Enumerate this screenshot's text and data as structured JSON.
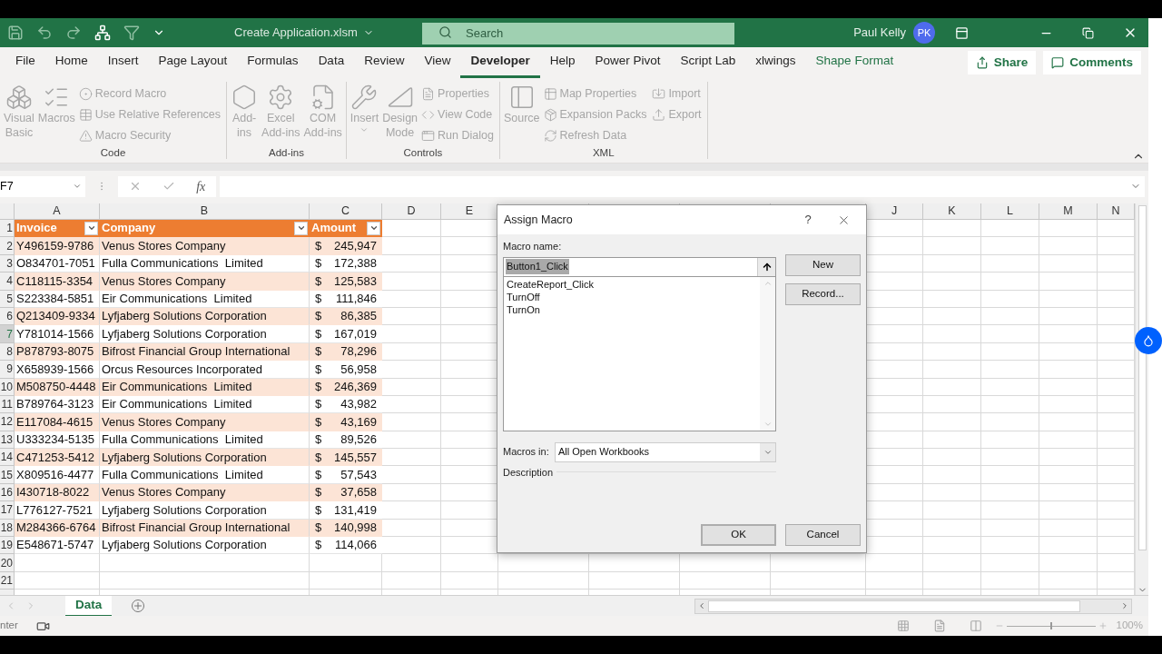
{
  "title_bar": {
    "file_name": "Create Application.xlsm",
    "search_placeholder": "Search",
    "user_name": "Paul Kelly",
    "avatar_initials": "PK"
  },
  "tabs": [
    {
      "label": "File",
      "selected": false,
      "kind": "normal"
    },
    {
      "label": "Home",
      "selected": false,
      "kind": "normal"
    },
    {
      "label": "Insert",
      "selected": false,
      "kind": "normal"
    },
    {
      "label": "Page Layout",
      "selected": false,
      "kind": "normal"
    },
    {
      "label": "Formulas",
      "selected": false,
      "kind": "normal"
    },
    {
      "label": "Data",
      "selected": false,
      "kind": "normal"
    },
    {
      "label": "Review",
      "selected": false,
      "kind": "normal"
    },
    {
      "label": "View",
      "selected": false,
      "kind": "normal"
    },
    {
      "label": "Developer",
      "selected": true,
      "kind": "normal"
    },
    {
      "label": "Help",
      "selected": false,
      "kind": "normal"
    },
    {
      "label": "Power Pivot",
      "selected": false,
      "kind": "normal"
    },
    {
      "label": "Script Lab",
      "selected": false,
      "kind": "normal"
    },
    {
      "label": "xlwings",
      "selected": false,
      "kind": "normal"
    },
    {
      "label": "Shape Format",
      "selected": false,
      "kind": "contextual"
    }
  ],
  "share_button": "Share",
  "comments_button": "Comments",
  "ribbon": {
    "groups": [
      {
        "label": "Code",
        "large": [
          {
            "lines": [
              "Visual",
              "Basic"
            ],
            "disabled": true
          },
          {
            "lines": [
              "Macros"
            ],
            "disabled": true
          }
        ],
        "small_columns": [
          [
            {
              "label": "Record Macro",
              "disabled": true
            },
            {
              "label": "Use Relative References",
              "disabled": true
            },
            {
              "label": "Macro Security",
              "disabled": true
            }
          ]
        ]
      },
      {
        "label": "Add-ins",
        "large": [
          {
            "lines": [
              "Add-",
              "ins"
            ],
            "disabled": true
          },
          {
            "lines": [
              "Excel",
              "Add-ins"
            ],
            "disabled": true
          },
          {
            "lines": [
              "COM",
              "Add-ins"
            ],
            "disabled": true
          }
        ]
      },
      {
        "label": "Controls",
        "large": [
          {
            "lines": [
              "Insert"
            ],
            "disabled": true
          },
          {
            "lines": [
              "Design",
              "Mode"
            ],
            "disabled": true
          }
        ],
        "small_columns": [
          [
            {
              "label": "Properties",
              "disabled": true
            },
            {
              "label": "View Code",
              "disabled": true
            },
            {
              "label": "Run Dialog",
              "disabled": true
            }
          ]
        ]
      },
      {
        "label": "XML",
        "large": [
          {
            "lines": [
              "Source"
            ],
            "disabled": true
          }
        ],
        "small_columns": [
          [
            {
              "label": "Map Properties",
              "disabled": true
            },
            {
              "label": "Expansion Packs",
              "disabled": true
            },
            {
              "label": "Refresh Data",
              "disabled": true
            }
          ],
          [
            {
              "label": "Import",
              "disabled": true
            },
            {
              "label": "Export",
              "disabled": true
            }
          ]
        ]
      }
    ]
  },
  "formula_bar": {
    "name_box": "F7",
    "function_symbol": "fx"
  },
  "columns": [
    {
      "label": "A"
    },
    {
      "label": "B"
    },
    {
      "label": "C"
    },
    {
      "label": "D"
    },
    {
      "label": "E"
    },
    {
      "label": "J"
    },
    {
      "label": "K"
    },
    {
      "label": "L"
    },
    {
      "label": "M"
    },
    {
      "label": "N"
    }
  ],
  "table": {
    "header": {
      "row": "1",
      "cells": [
        "Invoice",
        "Company",
        "Amount"
      ]
    },
    "rows": [
      {
        "row": "2",
        "invoice": "Y496159-9786",
        "company": "Venus Stores Company",
        "currency": "$",
        "amount": "245,947",
        "banded": true,
        "selected": false
      },
      {
        "row": "3",
        "invoice": "O834701-7051",
        "company": "Fulla Communications  Limited",
        "currency": "$",
        "amount": "172,388",
        "banded": false,
        "selected": false
      },
      {
        "row": "4",
        "invoice": "C118115-3354",
        "company": "Venus Stores Company",
        "currency": "$",
        "amount": "125,583",
        "banded": true,
        "selected": false
      },
      {
        "row": "5",
        "invoice": "S223384-5851",
        "company": "Eir Communications  Limited",
        "currency": "$",
        "amount": "111,846",
        "banded": false,
        "selected": false
      },
      {
        "row": "6",
        "invoice": "Q213409-9334",
        "company": "Lyfjaberg Solutions Corporation",
        "currency": "$",
        "amount": "86,385",
        "banded": true,
        "selected": false
      },
      {
        "row": "7",
        "invoice": "Y781014-1566",
        "company": "Lyfjaberg Solutions Corporation",
        "currency": "$",
        "amount": "167,019",
        "banded": false,
        "selected": true
      },
      {
        "row": "8",
        "invoice": "P878793-8075",
        "company": "Bifrost Financial Group International",
        "currency": "$",
        "amount": "78,296",
        "banded": true,
        "selected": false
      },
      {
        "row": "9",
        "invoice": "X658939-1566",
        "company": "Orcus Resources Incorporated",
        "currency": "$",
        "amount": "56,958",
        "banded": false,
        "selected": false
      },
      {
        "row": "10",
        "invoice": "M508750-4448",
        "company": "Eir Communications  Limited",
        "currency": "$",
        "amount": "246,369",
        "banded": true,
        "selected": false
      },
      {
        "row": "11",
        "invoice": "B789764-3123",
        "company": "Eir Communications  Limited",
        "currency": "$",
        "amount": "43,982",
        "banded": false,
        "selected": false
      },
      {
        "row": "12",
        "invoice": "E117084-4615",
        "company": "Venus Stores Company",
        "currency": "$",
        "amount": "43,169",
        "banded": true,
        "selected": false
      },
      {
        "row": "13",
        "invoice": "U333234-5135",
        "company": "Fulla Communications  Limited",
        "currency": "$",
        "amount": "89,526",
        "banded": false,
        "selected": false
      },
      {
        "row": "14",
        "invoice": "C471253-5412",
        "company": "Lyfjaberg Solutions Corporation",
        "currency": "$",
        "amount": "145,557",
        "banded": true,
        "selected": false
      },
      {
        "row": "15",
        "invoice": "X809516-4477",
        "company": "Fulla Communications  Limited",
        "currency": "$",
        "amount": "57,543",
        "banded": false,
        "selected": false
      },
      {
        "row": "16",
        "invoice": "I430718-8022",
        "company": "Venus Stores Company",
        "currency": "$",
        "amount": "37,658",
        "banded": true,
        "selected": false
      },
      {
        "row": "17",
        "invoice": "L776127-7521",
        "company": "Lyfjaberg Solutions Corporation",
        "currency": "$",
        "amount": "131,419",
        "banded": false,
        "selected": false
      },
      {
        "row": "18",
        "invoice": "M284366-6764",
        "company": "Bifrost Financial Group International",
        "currency": "$",
        "amount": "140,998",
        "banded": true,
        "selected": false
      },
      {
        "row": "19",
        "invoice": "E548671-5747",
        "company": "Lyfjaberg Solutions Corporation",
        "currency": "$",
        "amount": "114,066",
        "banded": false,
        "selected": false
      }
    ],
    "empty_rows": [
      "20",
      "21"
    ]
  },
  "sheet_tabs": [
    {
      "label": "Data",
      "selected": true
    }
  ],
  "status_bar": {
    "mode": "nter",
    "zoom": {
      "level": 0.5,
      "reading": "100%"
    }
  },
  "dialog": {
    "title": "Assign Macro",
    "help": "?",
    "macro_name_label": "Macro name:",
    "macro_name_value": "Button1_Click",
    "macros": [
      {
        "label": "CreateReport_Click",
        "selected": false
      },
      {
        "label": "TurnOff",
        "selected": false
      },
      {
        "label": "TurnOn",
        "selected": false
      }
    ],
    "new_button": "New",
    "record_button": "Record...",
    "macros_in_label": "Macros in:",
    "macros_in_value": "All Open Workbooks",
    "description_label": "Description",
    "ok_button": "OK",
    "cancel_button": "Cancel"
  }
}
